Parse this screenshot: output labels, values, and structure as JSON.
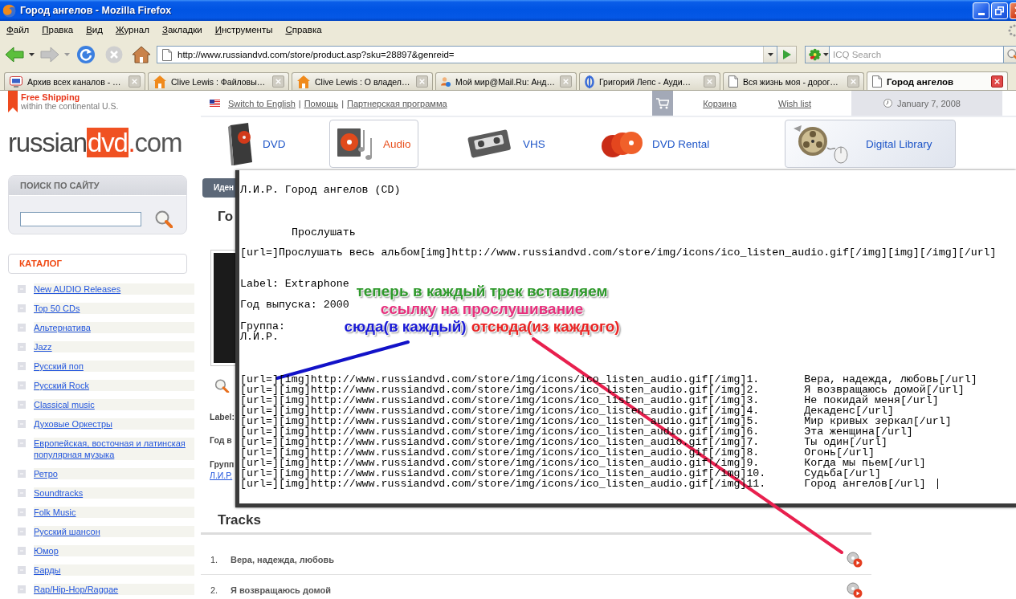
{
  "window": {
    "title": "Город ангелов - Mozilla Firefox"
  },
  "menu": [
    "Файл",
    "Правка",
    "Вид",
    "Журнал",
    "Закладки",
    "Инструменты",
    "Справка"
  ],
  "nav_buttons": [
    {
      "kind": "back",
      "disabled": false
    },
    {
      "kind": "forward",
      "disabled": true
    },
    {
      "kind": "reload",
      "disabled": false
    },
    {
      "kind": "stop",
      "disabled": true
    },
    {
      "kind": "home",
      "disabled": false
    }
  ],
  "address": "http://www.russiandvd.com/store/product.asp?sku=28897&genreid=",
  "web_search": {
    "placeholder": "ICQ Search"
  },
  "tabs": [
    {
      "label": "Архив всех каналов - …",
      "kind": "tv",
      "selected": false
    },
    {
      "label": "Clive Lewis : Файловы…",
      "kind": "house",
      "selected": false
    },
    {
      "label": "Clive Lewis : О владел…",
      "kind": "house",
      "selected": false
    },
    {
      "label": "Мой мир@Mail.Ru: Анд…",
      "kind": "people",
      "selected": false
    },
    {
      "label": "Григорий Лепс - Ауди…",
      "kind": "ring",
      "selected": false
    },
    {
      "label": "Вся жизнь моя - дорог…",
      "kind": "page",
      "selected": false
    },
    {
      "label": "Город ангелов",
      "kind": "page",
      "selected": true
    }
  ],
  "shipping": {
    "title": "Free Shipping",
    "subtitle": "within the continental U.S."
  },
  "logo": [
    "russian",
    "dvd",
    ".",
    "com"
  ],
  "site_search": {
    "title": "ПОИСК ПО САЙТУ"
  },
  "catalog": {
    "title": "КАТАЛОГ",
    "items": [
      "New AUDIO Releases",
      "Top 50 CDs",
      "Альтернатива",
      "Jazz",
      "Русский поп",
      "Русский Rock",
      "Classical music",
      "Духовые Оркестры",
      "Европейская, восточная и латинская популярная музыка",
      "Ретро",
      "Soundtracks",
      "Folk Music",
      "Русский шансон",
      "Юмор",
      "Барды",
      "Rap/Hip-Hop/Raggae"
    ]
  },
  "top_links": {
    "links": [
      "Switch to English",
      "Помощь",
      "Партнерская программа"
    ],
    "separator": "|"
  },
  "cart_link": "Корзина",
  "wishlist_link": "Wish list",
  "date": "January 7, 2008",
  "sections": [
    {
      "label": "DVD",
      "kind": "dvd",
      "selected": false
    },
    {
      "label": "Audio",
      "kind": "audio",
      "selected": true
    },
    {
      "label": "VHS",
      "kind": "vhs",
      "selected": false
    },
    {
      "label": "DVD Rental",
      "kind": "rental",
      "selected": false
    },
    {
      "label": "Digital Library",
      "kind": "library",
      "selected": false
    }
  ],
  "login_bar": {
    "label": "Иден"
  },
  "product": {
    "title": "Го",
    "details": [
      "Label:",
      "Год в",
      "Групп"
    ],
    "group_link": "Л.И.Р."
  },
  "editor": {
    "title": "Л.И.Р. Город ангелов (CD)",
    "listen_label": "Прослушать",
    "album_line": "[url=]Прослушать весь альбом[img]http://www.russiandvd.com/store/img/icons/ico_listen_audio.gif[/img][img][/img][/url]",
    "info_groups": [
      [
        "Label: Extraphone"
      ],
      [
        "Год выпуска: 2000"
      ],
      [
        "Группа:",
        "Л.И.Р."
      ]
    ],
    "track_lines": [
      {
        "text": "[url=][img]http://www.russiandvd.com/store/img/icons/ico_listen_audio.gif[/img]1.\tВера, надежда, любовь[/url]",
        "caret": false
      },
      {
        "text": "[url=][img]http://www.russiandvd.com/store/img/icons/ico_listen_audio.gif[/img]2.\tЯ возвращаюсь домой[/url]",
        "caret": false
      },
      {
        "text": "[url=][img]http://www.russiandvd.com/store/img/icons/ico_listen_audio.gif[/img]3.\tНе покидай меня[/url]",
        "caret": false
      },
      {
        "text": "[url=][img]http://www.russiandvd.com/store/img/icons/ico_listen_audio.gif[/img]4.\tДекаденс[/url]",
        "caret": false
      },
      {
        "text": "[url=][img]http://www.russiandvd.com/store/img/icons/ico_listen_audio.gif[/img]5.\tМир кривых зеркал[/url]",
        "caret": false
      },
      {
        "text": "[url=][img]http://www.russiandvd.com/store/img/icons/ico_listen_audio.gif[/img]6.\tЭта женщина[/url]",
        "caret": false
      },
      {
        "text": "[url=][img]http://www.russiandvd.com/store/img/icons/ico_listen_audio.gif[/img]7.\tТы один[/url]",
        "caret": false
      },
      {
        "text": "[url=][img]http://www.russiandvd.com/store/img/icons/ico_listen_audio.gif[/img]8.\tОгонь[/url]",
        "caret": false
      },
      {
        "text": "[url=][img]http://www.russiandvd.com/store/img/icons/ico_listen_audio.gif[/img]9.\tКогда мы пьем[/url]",
        "caret": false
      },
      {
        "text": "[url=][img]http://www.russiandvd.com/store/img/icons/ico_listen_audio.gif[/img]10.\tСудьба[/url]",
        "caret": false
      },
      {
        "text": "[url=][img]http://www.russiandvd.com/store/img/icons/ico_listen_audio.gif[/img]11.\tГород ангелов[/url]",
        "caret": true
      }
    ]
  },
  "annotations": [
    [
      {
        "text": "теперь в каждый трек вставляем",
        "color": "#2f9a2c"
      }
    ],
    [
      {
        "text": "ссылку на прослушивание",
        "color": "#e6307c"
      }
    ],
    [
      {
        "text": "сюда(в каждый)",
        "color": "#1a1ad6"
      },
      {
        "text": "отсюда(из каждого)",
        "color": "#ea2424"
      }
    ]
  ],
  "leader_lines": [
    {
      "color": "#1212c8"
    },
    {
      "color": "#e8204e"
    }
  ],
  "tracks": {
    "title": "Tracks",
    "rows": [
      {
        "number": "1.",
        "title": "Вера, надежда, любовь"
      },
      {
        "number": "2.",
        "title": "Я возвращаюсь домой"
      }
    ]
  }
}
